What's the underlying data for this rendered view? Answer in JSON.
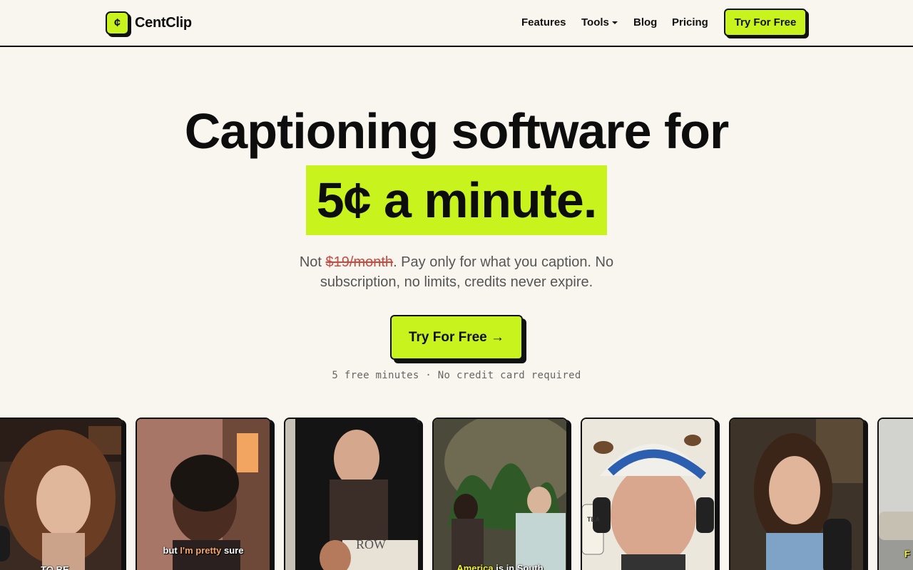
{
  "brand": {
    "name": "CentClip",
    "logo_glyph": "¢",
    "accent": "#c9f31d"
  },
  "nav": {
    "links": [
      {
        "label": "Features"
      },
      {
        "label": "Tools"
      },
      {
        "label": "Blog"
      },
      {
        "label": "Pricing"
      }
    ],
    "cta": "Try For Free"
  },
  "hero": {
    "headline_line1": "Captioning software for",
    "headline_line2": "5¢ a minute.",
    "sub_prefix": "Not ",
    "sub_strike": "$19/month",
    "sub_rest": ". Pay only for what you caption. No subscription, no limits, credits never expire.",
    "cta": "Try For Free →",
    "note": "5 free minutes · No credit card required"
  },
  "videos": [
    {
      "caption_parts": [
        "TO BE"
      ],
      "icon": "video-thumbnail"
    },
    {
      "caption_parts": [
        "but ",
        "I'm pretty",
        " sure"
      ],
      "icon": "video-thumbnail"
    },
    {
      "caption_parts": [],
      "icon": "video-thumbnail",
      "sign_text": "ROW"
    },
    {
      "caption_parts": [
        "America",
        " is in South"
      ],
      "icon": "video-thumbnail"
    },
    {
      "caption_parts": [],
      "icon": "video-thumbnail",
      "mug_text": "TEA"
    },
    {
      "caption_parts": [],
      "icon": "video-thumbnail"
    },
    {
      "caption_parts": [
        "F"
      ],
      "icon": "video-thumbnail"
    }
  ]
}
